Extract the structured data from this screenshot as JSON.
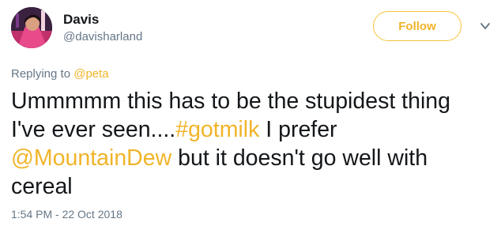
{
  "user": {
    "display_name": "Davis",
    "handle": "@davisharland"
  },
  "actions": {
    "follow_label": "Follow",
    "caret_icon": "chevron-down-icon"
  },
  "reply": {
    "prefix": "Replying to ",
    "mention": "@peta"
  },
  "tweet": {
    "line1": "Ummmmm this has to be the stupidest thing",
    "line2_text": "I've ever seen....",
    "line2_hashtag": "#gotmilk",
    "line2_rest": " I prefer",
    "line3_mention": "@MountainDew",
    "line3_rest": " but it doesn't go well with",
    "line4": "cereal"
  },
  "timestamp": "1:54 PM - 22 Oct 2018",
  "colors": {
    "accent": "#f0b429",
    "text": "#14171a",
    "muted": "#657786"
  }
}
